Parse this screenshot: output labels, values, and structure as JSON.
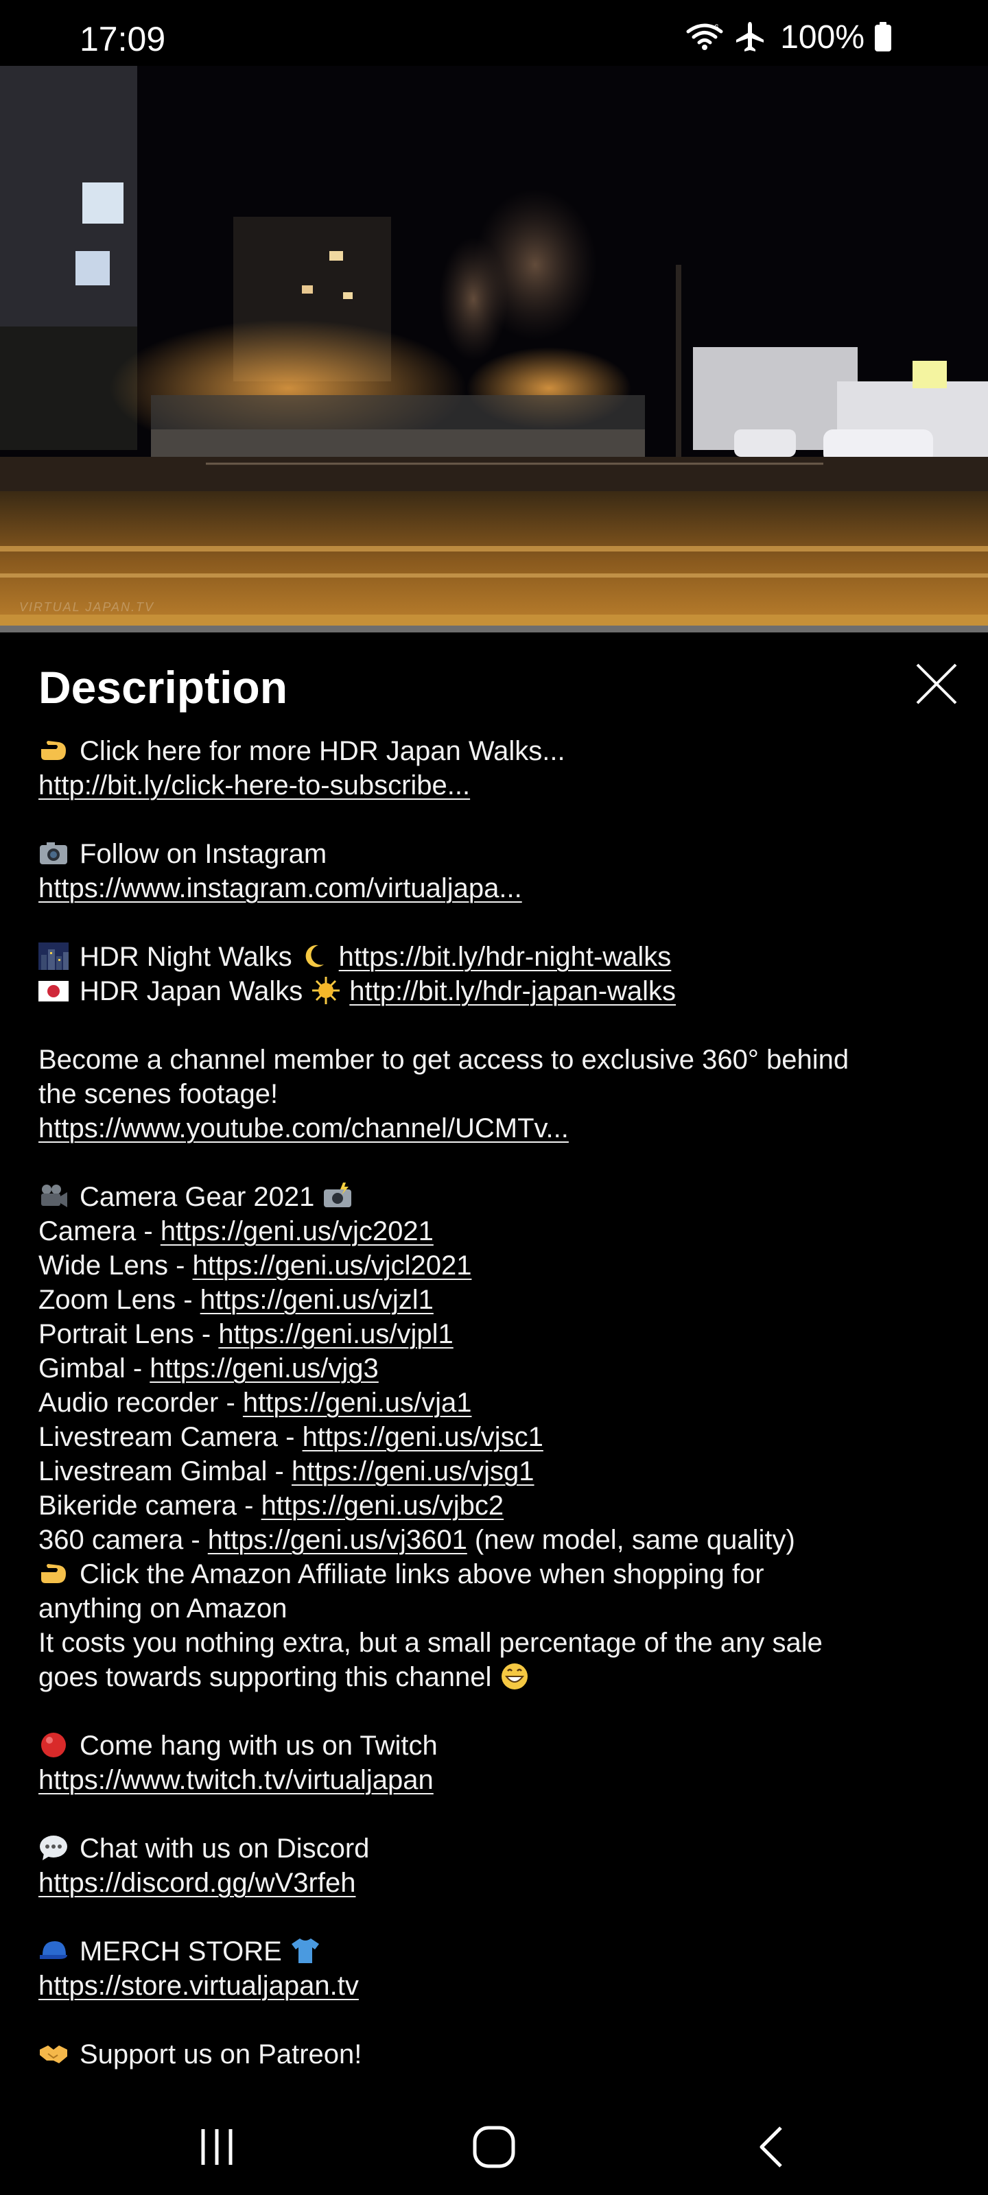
{
  "status_bar": {
    "time": "17:09",
    "battery": "100%",
    "icons": [
      "wifi-icon",
      "airplane-mode-icon",
      "battery-icon"
    ]
  },
  "video": {
    "watermark": "VIRTUAL JAPAN.TV",
    "progress": 0.0
  },
  "description": {
    "title": "Description",
    "lines": [
      {
        "icon": "pointing-hand-icon",
        "text": "Click here for more HDR Japan Walks..."
      },
      {
        "link": "http://bit.ly/click-here-to-subscribe..."
      },
      {},
      {
        "icon": "camera-icon",
        "text": "Follow on Instagram"
      },
      {
        "link": "https://www.instagram.com/virtualjapa..."
      },
      {},
      {
        "icon": "night-city-icon",
        "text": "HDR Night Walks",
        "icon2": "crescent-moon-icon",
        "link": "https://bit.ly/hdr-night-walks"
      },
      {
        "icon": "japan-flag-icon",
        "text": "HDR Japan Walks",
        "icon2": "sun-icon",
        "link": "http://bit.ly/hdr-japan-walks"
      },
      {},
      {
        "text": "Become a channel member to get access to exclusive 360° behind"
      },
      {
        "text": "the scenes footage!"
      },
      {
        "link": "https://www.youtube.com/channel/UCMTv..."
      },
      {},
      {
        "icon": "movie-camera-icon",
        "text": "Camera Gear 2021",
        "icon2": "camera-flash-icon"
      },
      {
        "text": "Camera - ",
        "link": "https://geni.us/vjc2021"
      },
      {
        "text": "Wide Lens - ",
        "link": "https://geni.us/vjcl2021"
      },
      {
        "text": "Zoom Lens - ",
        "link": "https://geni.us/vjzl1"
      },
      {
        "text": "Portrait Lens - ",
        "link": "https://geni.us/vjpl1"
      },
      {
        "text": "Gimbal - ",
        "link": "https://geni.us/vjg3"
      },
      {
        "text": "Audio recorder - ",
        "link": "https://geni.us/vja1"
      },
      {
        "text": "Livestream Camera - ",
        "link": "https://geni.us/vjsc1"
      },
      {
        "text": "Livestream Gimbal - ",
        "link": "https://geni.us/vjsg1"
      },
      {
        "text": "Bikeride camera - ",
        "link": "https://geni.us/vjbc2"
      },
      {
        "text": "360 camera - ",
        "link": "https://geni.us/vj3601",
        "suffix": " (new model, same quality)"
      },
      {
        "icon": "pointing-hand-icon",
        "text": "Click the Amazon Affiliate links above when shopping for"
      },
      {
        "text": "anything on Amazon"
      },
      {
        "text": "It costs you nothing extra, but a small percentage of the any sale"
      },
      {
        "text": "goes towards supporting this channel",
        "icon2": "grinning-face-icon"
      },
      {},
      {
        "icon": "red-circle-icon",
        "text": "Come hang with us on Twitch"
      },
      {
        "link": "https://www.twitch.tv/virtualjapan"
      },
      {},
      {
        "icon": "speech-bubble-icon",
        "text": "Chat with us on Discord"
      },
      {
        "link": "https://discord.gg/wV3rfeh"
      },
      {},
      {
        "icon": "cap-icon",
        "text": "MERCH STORE",
        "icon2": "tshirt-icon"
      },
      {
        "link": "https://store.virtualjapan.tv"
      },
      {},
      {
        "icon": "handshake-icon",
        "text": "Support us on Patreon!"
      }
    ]
  },
  "nav_bar": {
    "buttons": [
      "recent-apps-icon",
      "home-icon",
      "back-icon"
    ]
  },
  "colors": {
    "background": "#000000",
    "text": "#f2f2f2",
    "progress_track": "#6e6e6e"
  }
}
